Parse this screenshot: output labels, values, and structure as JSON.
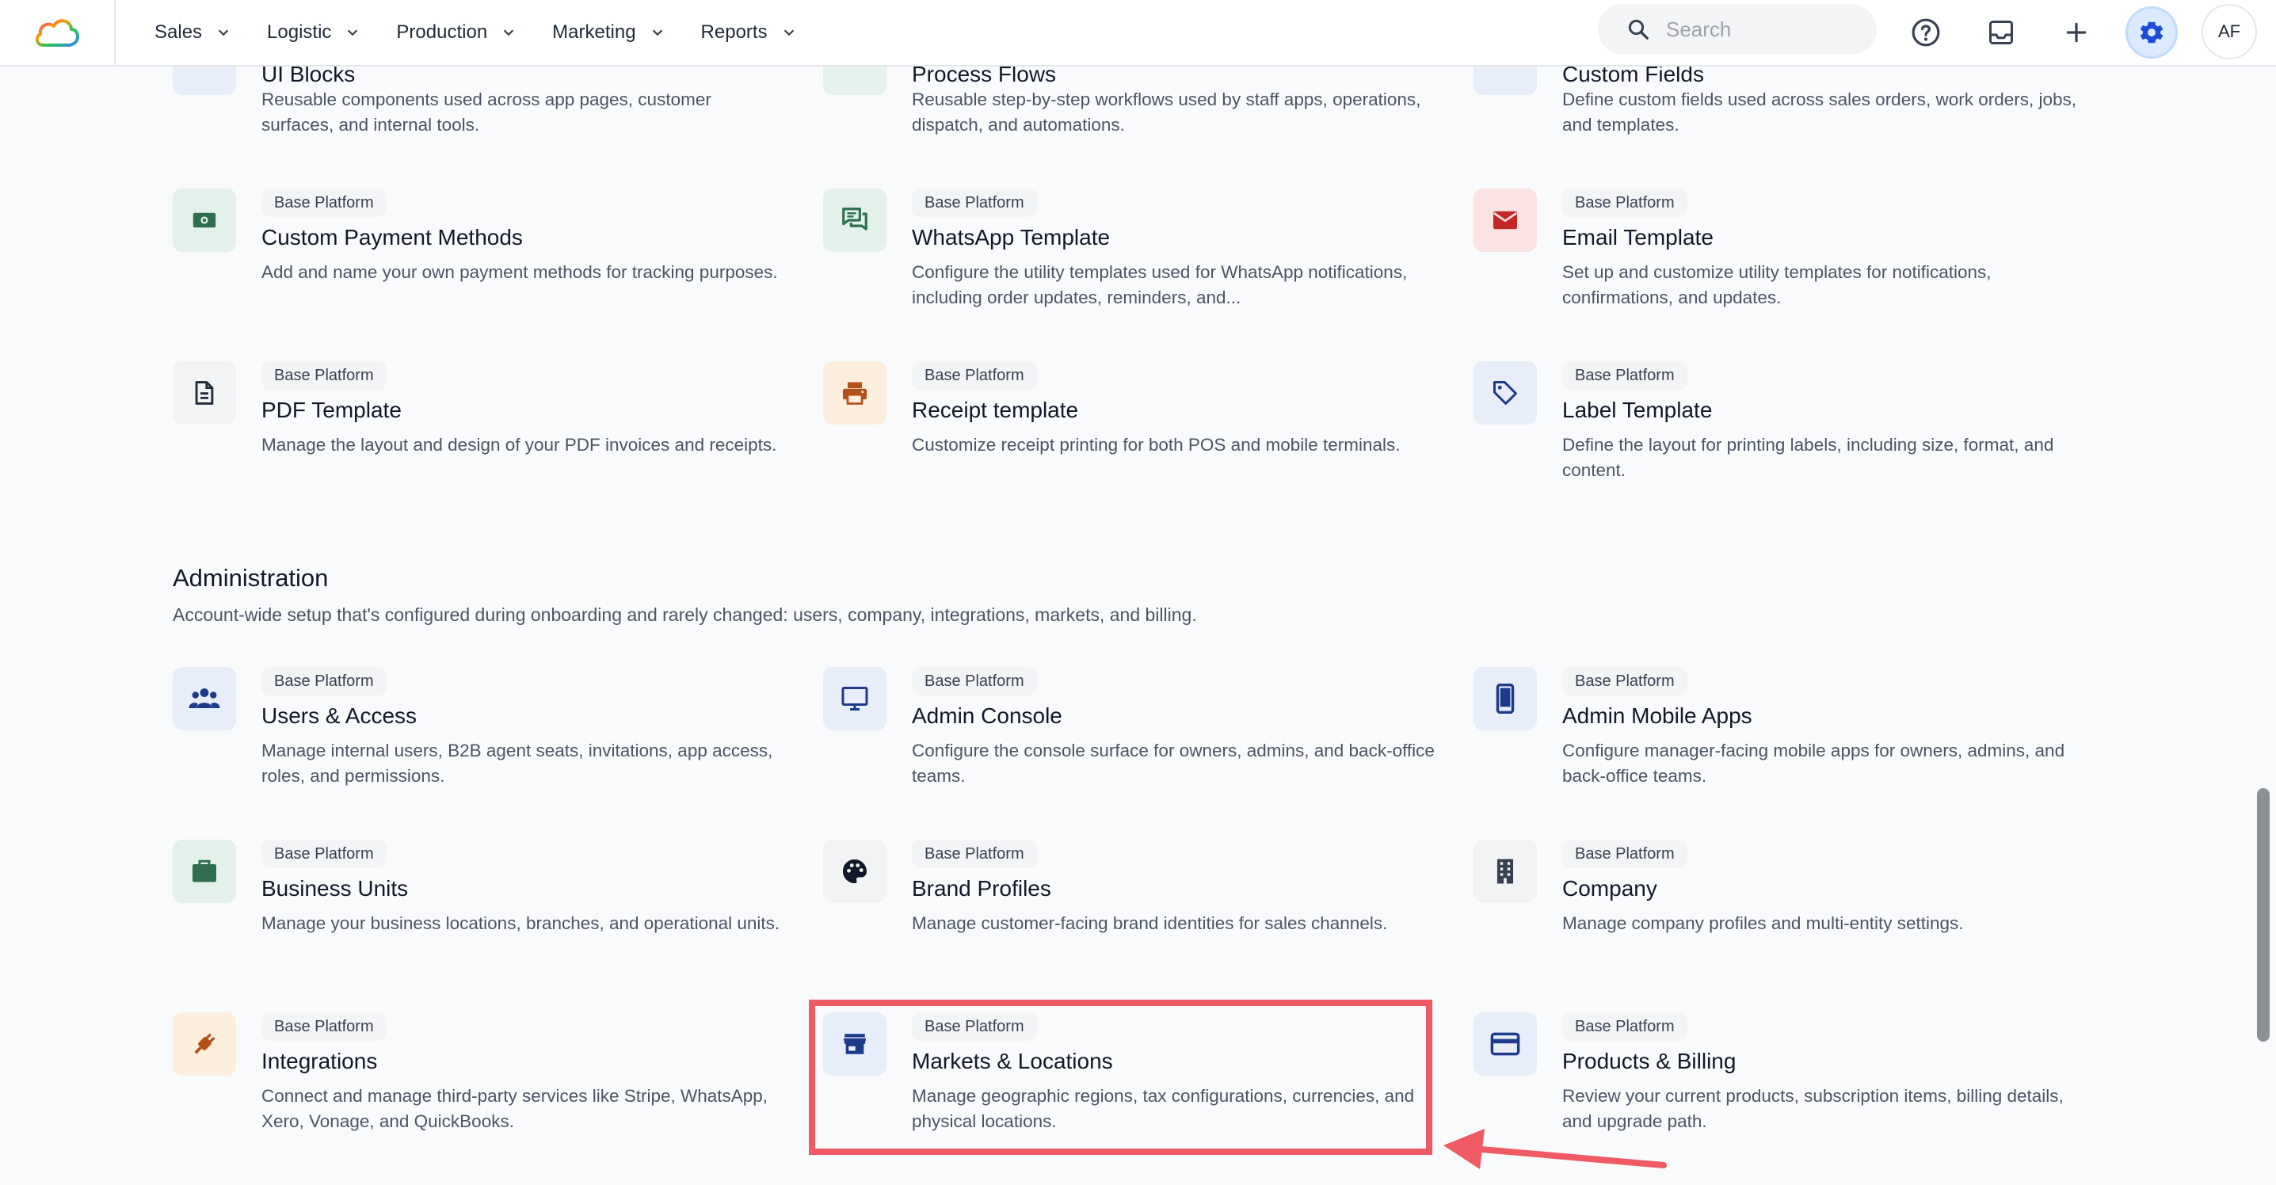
{
  "nav": {
    "items": [
      {
        "label": "Sales"
      },
      {
        "label": "Logistic"
      },
      {
        "label": "Production"
      },
      {
        "label": "Marketing"
      },
      {
        "label": "Reports"
      }
    ],
    "search_placeholder": "Search",
    "avatar_initials": "AF"
  },
  "colors": {
    "accent": "#2563eb",
    "highlight": "#ef5a65"
  },
  "partial_cards": [
    {
      "title": "UI Blocks",
      "desc": "Reusable components used across app pages, customer surfaces, and internal tools."
    },
    {
      "title": "Process Flows",
      "desc": "Reusable step-by-step workflows used by staff apps, operations, dispatch, and automations."
    },
    {
      "title": "Custom Fields",
      "desc": "Define custom fields used across sales orders, work orders, jobs, and templates."
    }
  ],
  "cards_top": [
    {
      "badge": "Base Platform",
      "title": "Custom Payment Methods",
      "desc": "Add and name your own payment methods for tracking purposes.",
      "icon": "cash-icon"
    },
    {
      "badge": "Base Platform",
      "title": "WhatsApp Template",
      "desc": "Configure the utility templates used for WhatsApp notifications, including order updates, reminders, and...",
      "icon": "chat-icon"
    },
    {
      "badge": "Base Platform",
      "title": "Email Template",
      "desc": "Set up and customize utility templates for notifications, confirmations, and updates.",
      "icon": "mail-icon"
    },
    {
      "badge": "Base Platform",
      "title": "PDF Template",
      "desc": "Manage the layout and design of your PDF invoices and receipts.",
      "icon": "document-icon"
    },
    {
      "badge": "Base Platform",
      "title": "Receipt template",
      "desc": "Customize receipt printing for both POS and mobile terminals.",
      "icon": "printer-icon"
    },
    {
      "badge": "Base Platform",
      "title": "Label Template",
      "desc": "Define the layout for printing labels, including size, format, and content.",
      "icon": "tag-icon"
    }
  ],
  "administration": {
    "title": "Administration",
    "desc": "Account-wide setup that's configured during onboarding and rarely changed: users, company, integrations, markets, and billing.",
    "cards": [
      {
        "badge": "Base Platform",
        "title": "Users & Access",
        "desc": "Manage internal users, B2B agent seats, invitations, app access, roles, and permissions.",
        "icon": "users-icon"
      },
      {
        "badge": "Base Platform",
        "title": "Admin Console",
        "desc": "Configure the console surface for owners, admins, and back-office teams.",
        "icon": "monitor-icon"
      },
      {
        "badge": "Base Platform",
        "title": "Admin Mobile Apps",
        "desc": "Configure manager-facing mobile apps for owners, admins, and back-office teams.",
        "icon": "phone-icon"
      },
      {
        "badge": "Base Platform",
        "title": "Business Units",
        "desc": "Manage your business locations, branches, and operational units.",
        "icon": "briefcase-icon"
      },
      {
        "badge": "Base Platform",
        "title": "Brand Profiles",
        "desc": "Manage customer-facing brand identities for sales channels.",
        "icon": "palette-icon"
      },
      {
        "badge": "Base Platform",
        "title": "Company",
        "desc": "Manage company profiles and multi-entity settings.",
        "icon": "building-icon"
      },
      {
        "badge": "Base Platform",
        "title": "Integrations",
        "desc": "Connect and manage third-party services like Stripe, WhatsApp, Xero, Vonage, and QuickBooks.",
        "icon": "plug-icon"
      },
      {
        "badge": "Base Platform",
        "title": "Markets & Locations",
        "desc": "Manage geographic regions, tax configurations, currencies, and physical locations.",
        "icon": "store-icon"
      },
      {
        "badge": "Base Platform",
        "title": "Products & Billing",
        "desc": "Review your current products, subscription items, billing details, and upgrade path.",
        "icon": "credit-card-icon"
      }
    ]
  }
}
